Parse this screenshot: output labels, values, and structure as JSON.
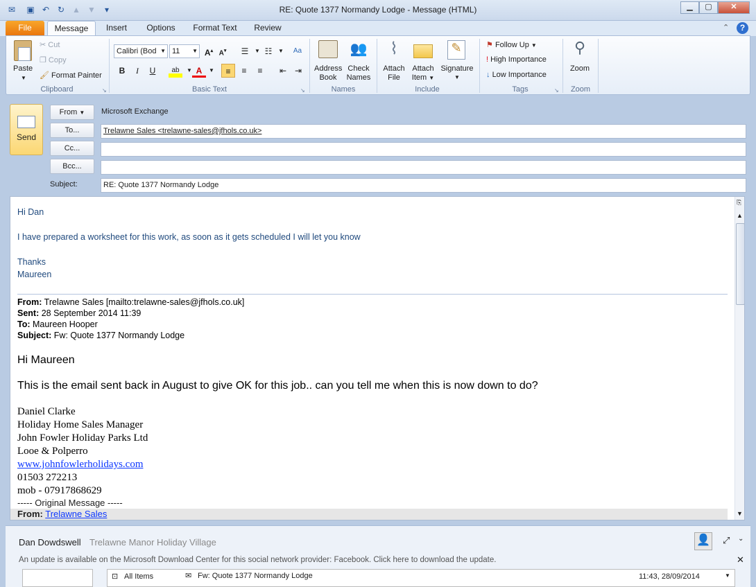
{
  "window": {
    "title": "RE: Quote 1377 Normandy Lodge  -  Message (HTML)"
  },
  "qat": {
    "icons": [
      "outlook-icon",
      "save-icon",
      "undo-icon",
      "redo-icon",
      "up-icon",
      "down-icon",
      "customize-icon"
    ]
  },
  "tabs": [
    "File",
    "Message",
    "Insert",
    "Options",
    "Format Text",
    "Review"
  ],
  "ribbon": {
    "clipboard": {
      "paste": "Paste",
      "cut": "Cut",
      "copy": "Copy",
      "format_painter": "Format Painter",
      "label": "Clipboard"
    },
    "basic_text": {
      "font": "Calibri (Bod",
      "size": "11",
      "label": "Basic Text"
    },
    "names": {
      "address_book_1": "Address",
      "address_book_2": "Book",
      "check_names_1": "Check",
      "check_names_2": "Names",
      "label": "Names"
    },
    "include": {
      "attach_file_1": "Attach",
      "attach_file_2": "File",
      "attach_item_1": "Attach",
      "attach_item_2": "Item",
      "signature": "Signature",
      "label": "Include"
    },
    "tags": {
      "follow_up": "Follow Up",
      "high": "High Importance",
      "low": "Low Importance",
      "label": "Tags"
    },
    "zoom": {
      "zoom": "Zoom",
      "label": "Zoom"
    }
  },
  "compose": {
    "send": "Send",
    "from_btn": "From",
    "from_value": "Microsoft Exchange",
    "to_btn": "To...",
    "to_value": "Trelawne Sales <trelawne-sales@jfhols.co.uk>",
    "cc_btn": "Cc...",
    "bcc_btn": "Bcc...",
    "subject_label": "Subject:",
    "subject_value": "RE: Quote 1377 Normandy Lodge"
  },
  "body": {
    "greeting": "Hi Dan",
    "line1": "I have prepared a worksheet for this work, as soon as it gets scheduled I will let you know",
    "thanks": "Thanks",
    "sig": "Maureen",
    "from_label": "From:",
    "from_value": " Trelawne Sales [mailto:trelawne-sales@jfhols.co.uk]",
    "sent_label": "Sent:",
    "sent_value": " 28 September 2014 11:39",
    "to_label": "To:",
    "to_value": " Maureen Hooper",
    "subj_label": "Subject:",
    "subj_value": " Fw: Quote 1377 Normandy Lodge",
    "hi": "Hi Maureen",
    "msg": "This is the email sent back in August to give OK for this job.. can you tell me when this is now down to do?",
    "s1": "Daniel Clarke",
    "s2": "Holiday Home Sales Manager",
    "s3": "John Fowler Holiday Parks Ltd",
    "s4": "Looe & Polperro",
    "s5": "www.johnfowlerholidays.com",
    "s6": "01503 272213",
    "s7": "mob - 07917868629",
    "orig": "----- Original Message -----",
    "orig_from_label": "From:",
    "orig_from_value": "Trelawne Sales"
  },
  "people_pane": {
    "name": "Dan Dowdswell",
    "company": "Trelawne Manor Holiday Village",
    "update": "An update is available on the Microsoft Download Center for this social network provider: Facebook. Click here to download the update.",
    "all_items": "All Items",
    "item_subject": "Fw: Quote 1377 Normandy Lodge",
    "item_time": "11:43, 28/09/2014"
  }
}
